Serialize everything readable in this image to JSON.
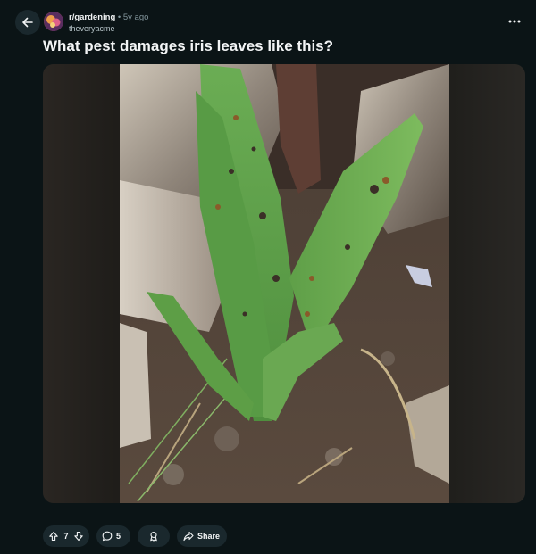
{
  "post": {
    "subreddit": "r/gardening",
    "separator": "•",
    "age": "5y ago",
    "author": "theveryacme",
    "title": "What pest damages iris leaves like this?"
  },
  "actions": {
    "vote_count": "7",
    "comment_count": "5",
    "share_label": "Share"
  },
  "icons": {
    "back": "arrow-left-icon",
    "more": "more-horizontal-icon",
    "upvote": "upvote-icon",
    "downvote": "downvote-icon",
    "comment": "comment-bubble-icon",
    "award": "award-icon",
    "share": "share-arrow-icon"
  },
  "colors": {
    "background": "#0b1416",
    "pill": "#1a282d",
    "text": "#f2f4f5",
    "muted": "#82959b"
  }
}
